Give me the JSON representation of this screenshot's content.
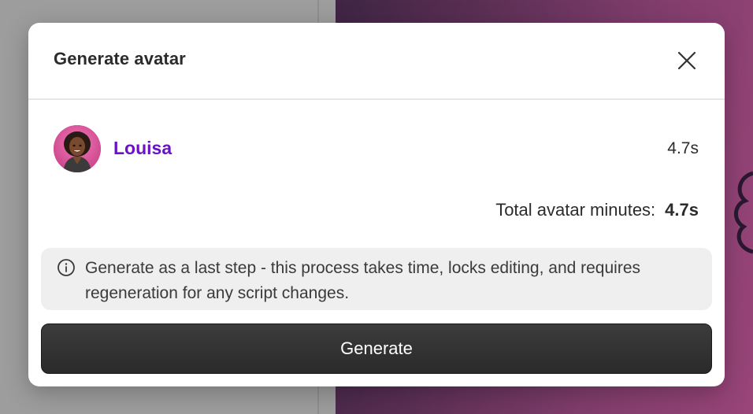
{
  "dialog": {
    "title": "Generate avatar",
    "close_icon": "close-icon"
  },
  "avatar_row": {
    "avatar_icon": "avatar",
    "name": "Louisa",
    "duration": "4.7s"
  },
  "total": {
    "label": "Total avatar minutes:",
    "value": "4.7s"
  },
  "info": {
    "icon": "info-icon",
    "text": "Generate as a last step - this process takes time, locks editing, and requires regeneration for any script changes."
  },
  "actions": {
    "generate_label": "Generate"
  },
  "colors": {
    "name_accent": "#6a12c4",
    "button_bg": "#2f2f2f",
    "info_bg": "#efefef"
  }
}
